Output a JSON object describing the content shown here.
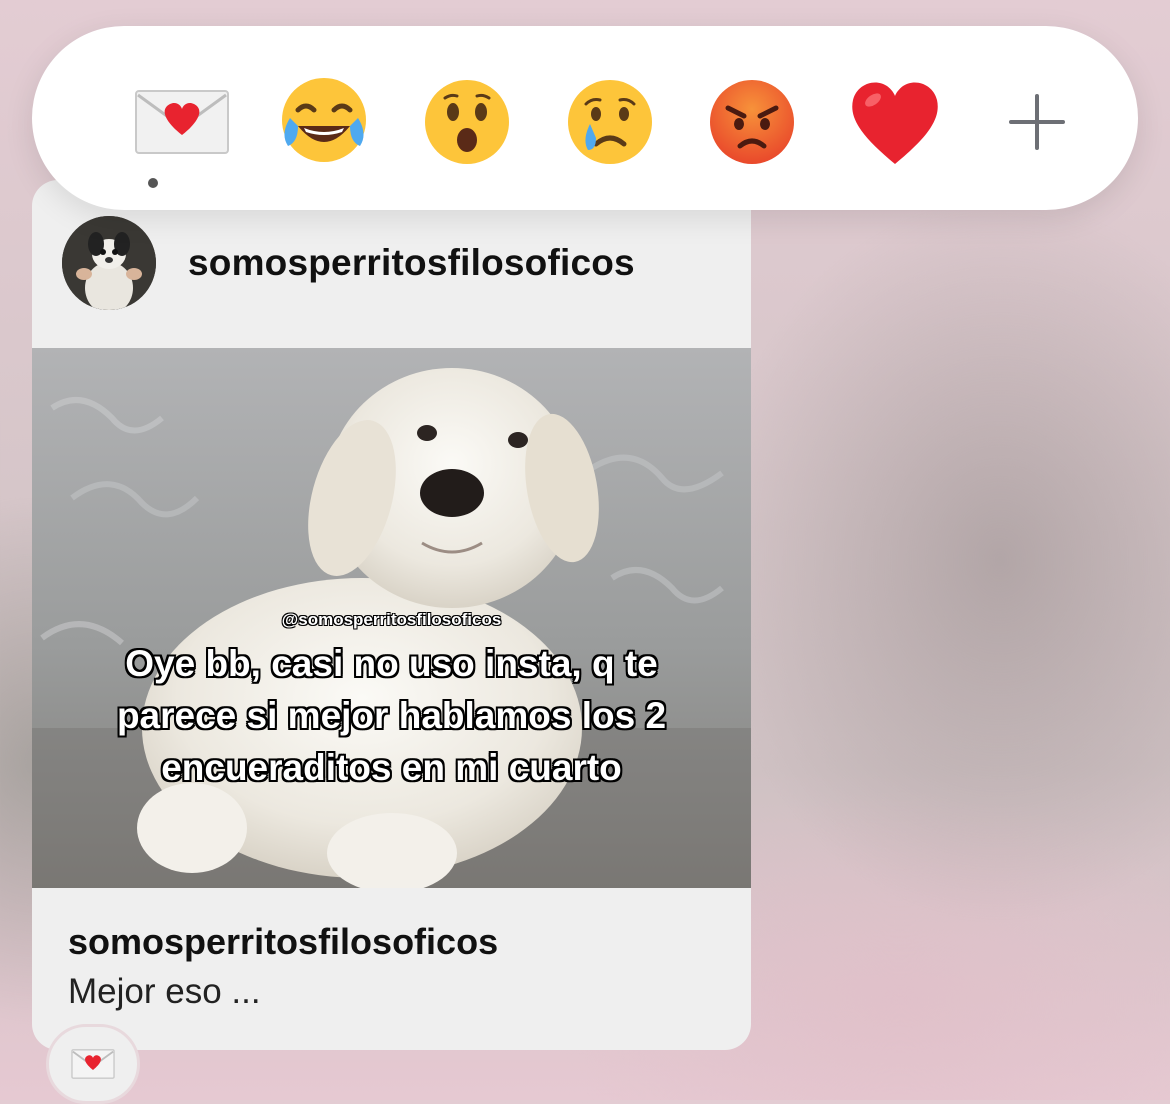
{
  "reactions": [
    {
      "name": "love-letter",
      "selected": true
    },
    {
      "name": "face-with-tears-of-joy",
      "selected": false
    },
    {
      "name": "face-with-open-mouth",
      "selected": false
    },
    {
      "name": "crying-face",
      "selected": false
    },
    {
      "name": "angry-face",
      "selected": false
    },
    {
      "name": "red-heart",
      "selected": false
    },
    {
      "name": "add-reaction",
      "selected": false
    }
  ],
  "shared_post": {
    "account": "somosperritosfilosoficos",
    "image_watermark": "@somosperritosfilosoficos",
    "image_caption": "Oye bb, casi no uso insta, q te parece si mejor hablamos los 2 encueraditos en mi cuarto",
    "footer_account": "somosperritosfilosoficos",
    "footer_text": "Mejor eso ..."
  },
  "message_reaction": {
    "icon": "love-letter"
  },
  "colors": {
    "heart_red": "#e8232f",
    "emoji_yellow": "#fdc53a",
    "angry_orange": "#f0522b"
  }
}
